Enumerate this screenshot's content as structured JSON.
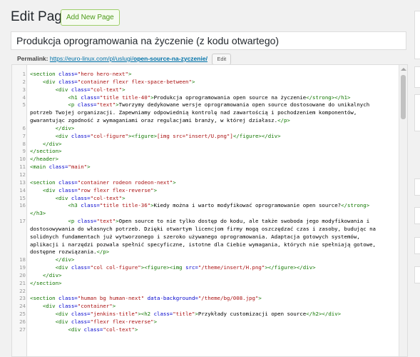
{
  "header": {
    "title": "Edit Page",
    "add_new_label": "Add New Page"
  },
  "post_title": "Produkcja oprogramowania na życzenie (z kodu otwartego)",
  "permalink": {
    "label": "Permalink:",
    "base_url": "https://euro-linux.com/pl/uslugi/",
    "slug": "open-source-na-zyczenie/",
    "edit_label": "Edit"
  },
  "editor": {
    "lines": [
      {
        "n": "1",
        "segs": [
          [
            "tag",
            "<section "
          ],
          [
            "attr",
            "class="
          ],
          [
            "str",
            "\"hero hero-next\""
          ],
          [
            "tag",
            ">"
          ]
        ]
      },
      {
        "n": "2",
        "segs": [
          [
            "txt",
            "    "
          ],
          [
            "tag",
            "<div "
          ],
          [
            "attr",
            "class="
          ],
          [
            "str",
            "\"container flexr flex-space-between\""
          ],
          [
            "tag",
            ">"
          ]
        ]
      },
      {
        "n": "3",
        "segs": [
          [
            "txt",
            "        "
          ],
          [
            "tag",
            "<div "
          ],
          [
            "attr",
            "class="
          ],
          [
            "str",
            "\"col-text\""
          ],
          [
            "tag",
            ">"
          ]
        ]
      },
      {
        "n": "4",
        "segs": [
          [
            "txt",
            "            "
          ],
          [
            "tag",
            "<h1 "
          ],
          [
            "attr",
            "class="
          ],
          [
            "str",
            "\"title title-40\""
          ],
          [
            "tag",
            ">"
          ],
          [
            "txt",
            "Produkcja oprogramowania open source na życzenie"
          ],
          [
            "tag",
            "</strong></h1>"
          ]
        ]
      },
      {
        "n": "5",
        "segs": [
          [
            "txt",
            "            "
          ],
          [
            "tag",
            "<p "
          ],
          [
            "attr",
            "class="
          ],
          [
            "str",
            "\"text\""
          ],
          [
            "tag",
            ">"
          ],
          [
            "txt",
            "Tworzymy dedykowane wersje oprogramowania open source dostosowane do unikalnych"
          ]
        ]
      },
      {
        "n": "",
        "segs": [
          [
            "txt",
            "potrzeb Twojej organizacji. Zapewniamy odpowiednią kontrolę nad zawartością i pochodzeniem komponentów,"
          ]
        ]
      },
      {
        "n": "",
        "segs": [
          [
            "txt",
            "gwarantując zgodność z wymaganiami oraz regulacjami branży, w której działasz."
          ],
          [
            "tag",
            "</p>"
          ]
        ]
      },
      {
        "n": "6",
        "segs": [
          [
            "txt",
            "        "
          ],
          [
            "tag",
            "</div>"
          ]
        ]
      },
      {
        "n": "7",
        "segs": [
          [
            "txt",
            "        "
          ],
          [
            "tag",
            "<div "
          ],
          [
            "attr",
            "class="
          ],
          [
            "str",
            "\"col-figure\""
          ],
          [
            "tag",
            "><figure>"
          ],
          [
            "str",
            "[img src=\"insert/U.png\"]"
          ],
          [
            "tag",
            "</figure></div>"
          ]
        ]
      },
      {
        "n": "8",
        "segs": [
          [
            "txt",
            "    "
          ],
          [
            "tag",
            "</div>"
          ]
        ]
      },
      {
        "n": "9",
        "segs": [
          [
            "tag",
            "</section>"
          ]
        ]
      },
      {
        "n": "10",
        "segs": [
          [
            "tag",
            "</header>"
          ]
        ]
      },
      {
        "n": "11",
        "segs": [
          [
            "tag",
            "<main "
          ],
          [
            "attr",
            "class="
          ],
          [
            "str",
            "\"main\""
          ],
          [
            "tag",
            ">"
          ]
        ]
      },
      {
        "n": "12",
        "segs": []
      },
      {
        "n": "13",
        "segs": [
          [
            "tag",
            "<section "
          ],
          [
            "attr",
            "class="
          ],
          [
            "str",
            "\"container rodeon rodeon-next\""
          ],
          [
            "tag",
            ">"
          ]
        ]
      },
      {
        "n": "14",
        "segs": [
          [
            "txt",
            "    "
          ],
          [
            "tag",
            "<div "
          ],
          [
            "attr",
            "class="
          ],
          [
            "str",
            "\"row flexr flex-reverse\""
          ],
          [
            "tag",
            ">"
          ]
        ]
      },
      {
        "n": "15",
        "segs": [
          [
            "txt",
            "        "
          ],
          [
            "tag",
            "<div "
          ],
          [
            "attr",
            "class="
          ],
          [
            "str",
            "\"col-text\""
          ],
          [
            "tag",
            ">"
          ]
        ]
      },
      {
        "n": "16",
        "segs": [
          [
            "txt",
            "            "
          ],
          [
            "tag",
            "<h3 "
          ],
          [
            "attr",
            "class="
          ],
          [
            "str",
            "\"title title-36\""
          ],
          [
            "tag",
            ">"
          ],
          [
            "txt",
            "Kiedy można i warto modyfikować oprogramowanie open source?"
          ],
          [
            "tag",
            "</strong>"
          ]
        ]
      },
      {
        "n": "",
        "segs": [
          [
            "tag",
            "</h3>"
          ]
        ]
      },
      {
        "n": "17",
        "segs": [
          [
            "txt",
            "            "
          ],
          [
            "tag",
            "<p "
          ],
          [
            "attr",
            "class="
          ],
          [
            "str",
            "\"text\""
          ],
          [
            "tag",
            ">"
          ],
          [
            "txt",
            "Open source to nie tylko dostęp do kodu, ale także swoboda jego modyfikowania i"
          ]
        ]
      },
      {
        "n": "",
        "segs": [
          [
            "txt",
            "dostosowywania do własnych potrzeb. Dzięki otwartym licencjom firmy mogą oszczędzać czas i zasoby, budując na"
          ]
        ]
      },
      {
        "n": "",
        "segs": [
          [
            "txt",
            "solidnych fundamentach już wytworzonego i szeroko używanego oprogramowania. Adaptacja gotowych systemów,"
          ]
        ]
      },
      {
        "n": "",
        "segs": [
          [
            "txt",
            "aplikacji i narzędzi pozwala spełnić specyficzne, istotne dla Ciebie wymagania, których nie spełniają gotowe,"
          ]
        ]
      },
      {
        "n": "",
        "segs": [
          [
            "txt",
            "dostępne rozwiązania."
          ],
          [
            "tag",
            "</p>"
          ]
        ]
      },
      {
        "n": "18",
        "segs": [
          [
            "txt",
            "        "
          ],
          [
            "tag",
            "</div>"
          ]
        ]
      },
      {
        "n": "19",
        "segs": [
          [
            "txt",
            "        "
          ],
          [
            "tag",
            "<div "
          ],
          [
            "attr",
            "class="
          ],
          [
            "str",
            "\"col col-figure\""
          ],
          [
            "tag",
            "><figure><img "
          ],
          [
            "attr",
            "src="
          ],
          [
            "str",
            "\"/theme/insert/H.png\""
          ],
          [
            "tag",
            "></figure></div>"
          ]
        ]
      },
      {
        "n": "20",
        "segs": [
          [
            "txt",
            "    "
          ],
          [
            "tag",
            "</div>"
          ]
        ]
      },
      {
        "n": "21",
        "segs": [
          [
            "tag",
            "</section>"
          ]
        ]
      },
      {
        "n": "22",
        "segs": []
      },
      {
        "n": "23",
        "segs": [
          [
            "tag",
            "<section "
          ],
          [
            "attr",
            "class="
          ],
          [
            "str",
            "\"human bg human-next\""
          ],
          [
            "txt",
            " "
          ],
          [
            "attr",
            "data-background="
          ],
          [
            "str",
            "\"/theme/bg/008.jpg\""
          ],
          [
            "tag",
            ">"
          ]
        ]
      },
      {
        "n": "24",
        "segs": [
          [
            "txt",
            "    "
          ],
          [
            "tag",
            "<div "
          ],
          [
            "attr",
            "class="
          ],
          [
            "str",
            "\"container\""
          ],
          [
            "tag",
            ">"
          ]
        ]
      },
      {
        "n": "25",
        "segs": [
          [
            "txt",
            "        "
          ],
          [
            "tag",
            "<div "
          ],
          [
            "attr",
            "class="
          ],
          [
            "str",
            "\"jenkins-title\""
          ],
          [
            "tag",
            "><h2 "
          ],
          [
            "attr",
            "class="
          ],
          [
            "str",
            "\"title\""
          ],
          [
            "tag",
            ">"
          ],
          [
            "txt",
            "Przykłady customizacji open source"
          ],
          [
            "tag",
            "</h2></div>"
          ]
        ]
      },
      {
        "n": "26",
        "segs": [
          [
            "txt",
            "        "
          ],
          [
            "tag",
            "<div "
          ],
          [
            "attr",
            "class="
          ],
          [
            "str",
            "\"flexr flex-reverse\""
          ],
          [
            "tag",
            ">"
          ]
        ]
      },
      {
        "n": "27",
        "segs": [
          [
            "txt",
            "            "
          ],
          [
            "tag",
            "<div "
          ],
          [
            "attr",
            "class="
          ],
          [
            "str",
            "\"col-text\""
          ],
          [
            "tag",
            ">"
          ]
        ]
      }
    ]
  }
}
